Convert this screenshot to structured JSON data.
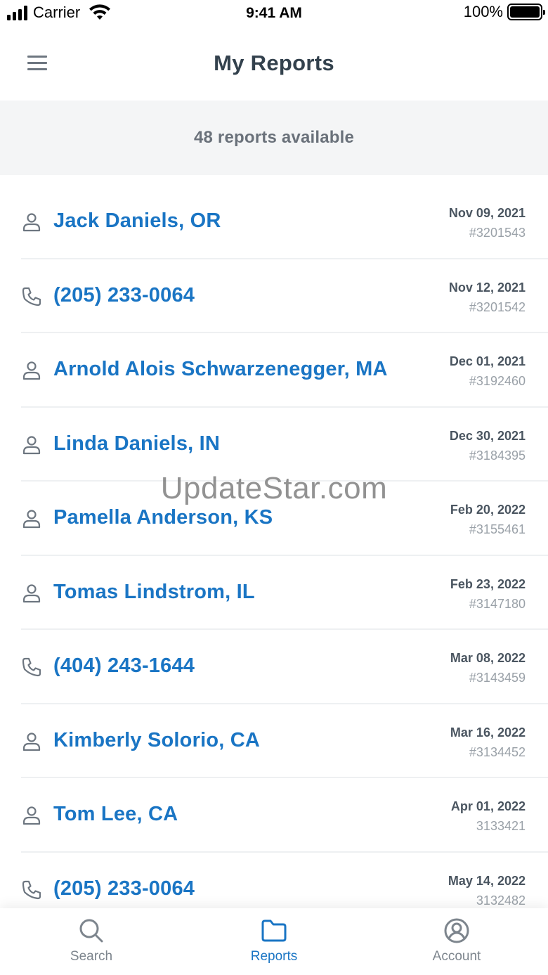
{
  "status_bar": {
    "carrier": "Carrier",
    "time": "9:41 AM",
    "battery": "100%"
  },
  "header": {
    "title": "My Reports",
    "menu_icon": "hamburger-menu-icon"
  },
  "summary": {
    "text": "48 reports available"
  },
  "reports": [
    {
      "type": "person",
      "icon": "person-icon",
      "title": "Jack Daniels, OR",
      "date": "Nov 09, 2021",
      "id": "#3201543"
    },
    {
      "type": "phone",
      "icon": "phone-icon",
      "title": "(205) 233-0064",
      "date": "Nov 12, 2021",
      "id": "#3201542"
    },
    {
      "type": "person",
      "icon": "person-icon",
      "title": "Arnold Alois Schwarzenegger, MA",
      "date": "Dec 01, 2021",
      "id": "#3192460"
    },
    {
      "type": "person",
      "icon": "person-icon",
      "title": "Linda Daniels, IN",
      "date": "Dec 30, 2021",
      "id": "#3184395"
    },
    {
      "type": "person",
      "icon": "person-icon",
      "title": "Pamella Anderson, KS",
      "date": "Feb 20, 2022",
      "id": "#3155461"
    },
    {
      "type": "person",
      "icon": "person-icon",
      "title": "Tomas Lindstrom, IL",
      "date": "Feb 23, 2022",
      "id": "#3147180"
    },
    {
      "type": "phone",
      "icon": "phone-icon",
      "title": "(404) 243-1644",
      "date": "Mar 08, 2022",
      "id": "#3143459"
    },
    {
      "type": "person",
      "icon": "person-icon",
      "title": "Kimberly Solorio, CA",
      "date": "Mar 16, 2022",
      "id": "#3134452"
    },
    {
      "type": "person",
      "icon": "person-icon",
      "title": "Tom Lee, CA",
      "date": "Apr 01, 2022",
      "id": "3133421"
    },
    {
      "type": "phone",
      "icon": "phone-icon",
      "title": "(205) 233-0064",
      "date": "May 14, 2022",
      "id": "3132482"
    }
  ],
  "watermark": "UpdateStar.com",
  "tabs": [
    {
      "label": "Search",
      "icon": "search-icon",
      "active": false
    },
    {
      "label": "Reports",
      "icon": "folder-icon",
      "active": true
    },
    {
      "label": "Account",
      "icon": "account-icon",
      "active": false
    }
  ],
  "colors": {
    "accent": "#1a75c4",
    "muted": "#7d858d",
    "summary_bg": "#f4f5f6"
  }
}
